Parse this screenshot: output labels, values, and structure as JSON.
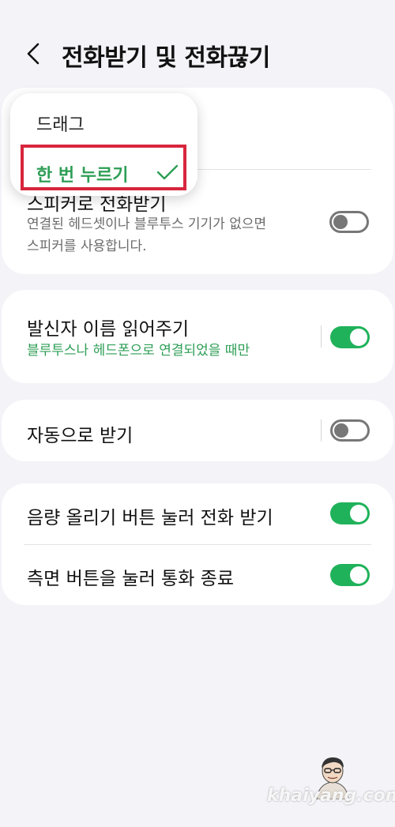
{
  "header": {
    "title": "전화받기 및 전화끊기"
  },
  "answer_method_popup": {
    "options": [
      {
        "label": "드래그"
      },
      {
        "label": "한 번 누르기",
        "selected": true
      }
    ]
  },
  "speaker_answer": {
    "title": "스피커로 전화받기",
    "description_line1": "연결된 헤드셋이나 블루투스 기기가 없으면",
    "description_line2": "스피커를 사용합니다.",
    "enabled": false
  },
  "read_caller_name": {
    "title": "발신자 이름 읽어주기",
    "description": "블루투스나 헤드폰으로 연결되었을 때만",
    "enabled": true
  },
  "auto_answer": {
    "title": "자동으로 받기",
    "enabled": false
  },
  "volume_up_answer": {
    "title": "음량 올리기 버튼 눌러 전화 받기",
    "enabled": true
  },
  "side_key_end": {
    "title": "측면 버튼을 눌러 통화 종료",
    "enabled": true
  },
  "watermark": "khaiyang.com",
  "colors": {
    "accent_green": "#1fb25a",
    "highlight_red": "#d7263d",
    "background": "#f3f3f8"
  }
}
